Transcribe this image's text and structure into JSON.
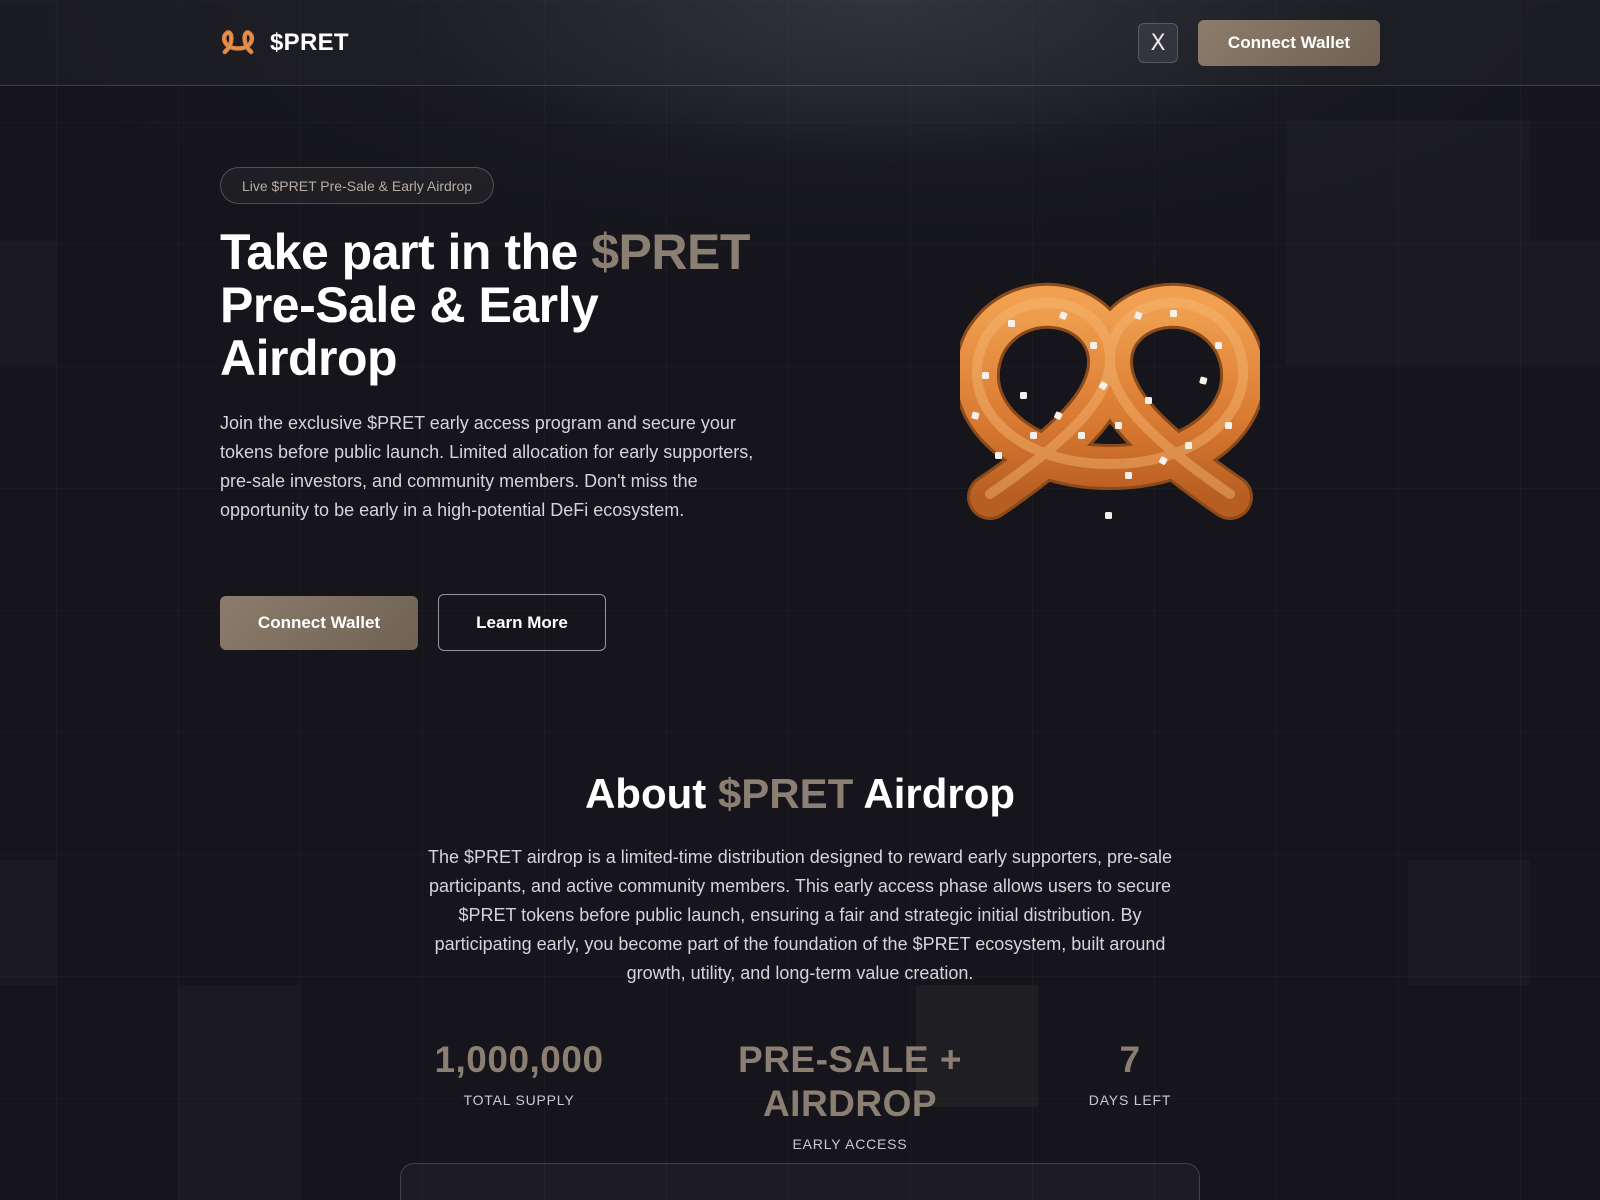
{
  "header": {
    "logo_text": "$PRET",
    "x_icon": "X",
    "connect_label": "Connect Wallet"
  },
  "hero": {
    "badge": "Live $PRET Pre-Sale & Early Airdrop",
    "title_part1": "Take part in the ",
    "title_accent": "$PRET",
    "title_part2": "Pre-Sale & Early Airdrop",
    "description": "Join the exclusive $PRET early access program and secure your tokens before public launch. Limited allocation for early supporters, pre-sale investors, and community members. Don't miss the opportunity to be early in a high-potential DeFi ecosystem.",
    "connect_label": "Connect Wallet",
    "learn_label": "Learn More",
    "image_icon": "pretzel"
  },
  "about": {
    "title_part1": "About ",
    "title_accent": "$PRET",
    "title_part2": " Airdrop",
    "description": "The $PRET airdrop is a limited-time distribution designed to reward early supporters, pre-sale participants, and active community members. This early access phase allows users to secure $PRET tokens before public launch, ensuring a fair and strategic initial distribution. By participating early, you become part of the foundation of the $PRET ecosystem, built around growth, utility, and long-term value creation."
  },
  "stats": [
    {
      "value": "1,000,000",
      "label": "TOTAL SUPPLY"
    },
    {
      "value": "PRE-SALE + AIRDROP",
      "label": "EARLY ACCESS"
    },
    {
      "value": "7",
      "label": "DAYS LEFT"
    }
  ],
  "colors": {
    "accent": "#8b7e72",
    "button": "#7d6f60",
    "background": "#15151b"
  }
}
